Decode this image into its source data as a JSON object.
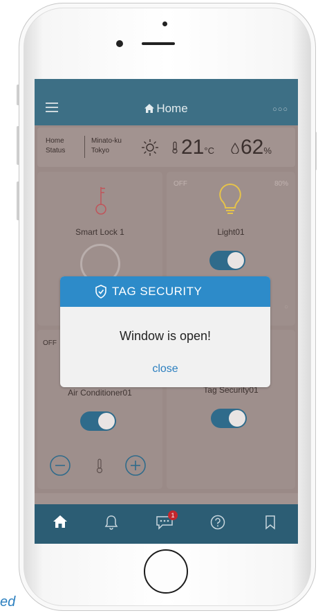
{
  "header": {
    "title": "Home"
  },
  "status": {
    "label_line1": "Home",
    "label_line2": "Status",
    "location_line1": "Minato-ku",
    "location_line2": "Tokyo",
    "temperature": "21",
    "temperature_unit": "°C",
    "humidity": "62",
    "humidity_unit": "%"
  },
  "cards": {
    "smart_lock": {
      "label": "Smart Lock 1"
    },
    "light": {
      "label": "Light01",
      "state": "OFF",
      "level": "80%"
    },
    "air_conditioner": {
      "label": "Air Conditioner01",
      "state": "OFF"
    },
    "tag_security": {
      "label": "Tag Security01"
    }
  },
  "dialog": {
    "title": "TAG SECURITY",
    "message": "Window is open!",
    "close_label": "close"
  },
  "tab_bar": {
    "chat_badge": "1"
  },
  "colors": {
    "header": "#3d6f85",
    "dialog_header": "#2d8bc9",
    "tab_bar": "#2c5d74",
    "toggle_on": "#2f6b8b",
    "badge": "#c2272d"
  },
  "footer_text": "ed"
}
